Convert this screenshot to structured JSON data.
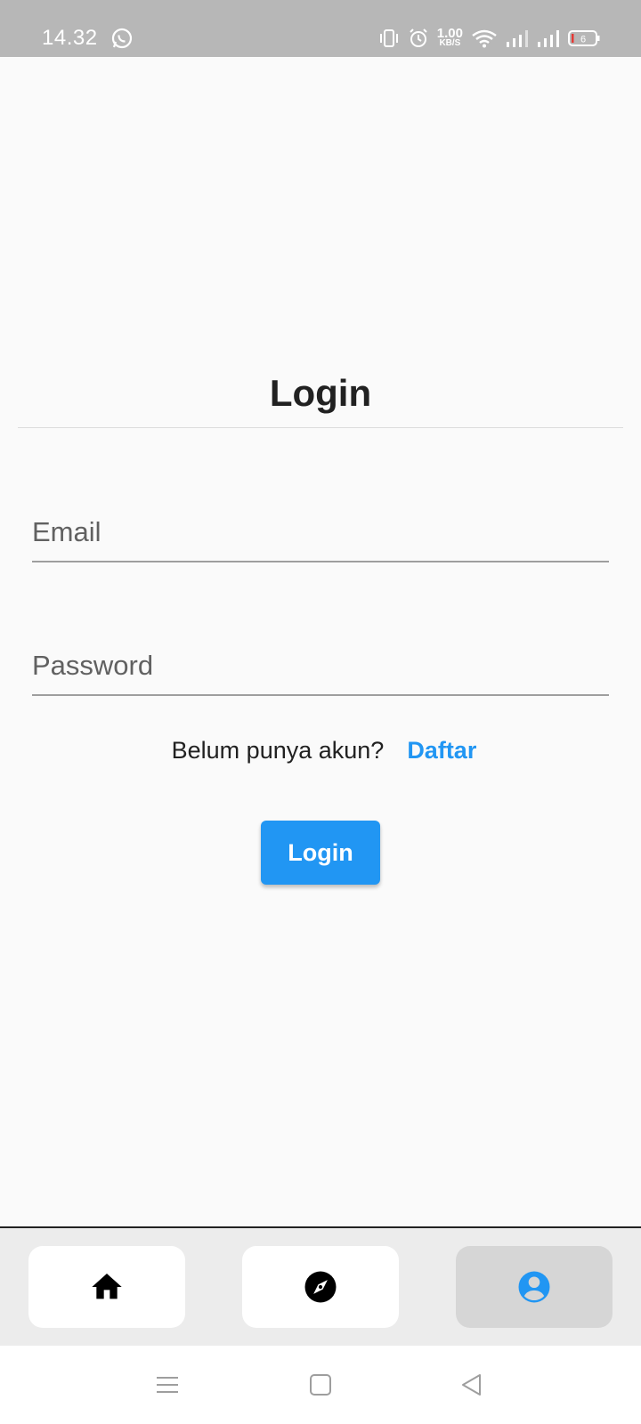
{
  "status_bar": {
    "time": "14.32",
    "net_speed_value": "1.00",
    "net_speed_unit": "KB/S",
    "battery_level": "6",
    "icons": [
      "whatsapp-icon",
      "vibrate-icon",
      "alarm-icon",
      "wifi-icon",
      "signal-icon",
      "signal-icon",
      "battery-icon"
    ]
  },
  "login": {
    "title": "Login",
    "email_placeholder": "Email",
    "email_value": "",
    "password_placeholder": "Password",
    "password_value": "",
    "register_prompt": "Belum punya akun?",
    "register_link": "Daftar",
    "submit_label": "Login"
  },
  "bottom_nav": {
    "items": [
      {
        "icon": "home-icon",
        "active": false
      },
      {
        "icon": "compass-icon",
        "active": false
      },
      {
        "icon": "account-circle-icon",
        "active": true
      }
    ]
  },
  "system_nav": {
    "icons": [
      "menu-icon",
      "home-square-icon",
      "back-icon"
    ]
  },
  "colors": {
    "accent": "#2196f3",
    "background": "#fafafa",
    "status_bar": "#b7b7b7",
    "nav_active": "#d6d6d6"
  }
}
